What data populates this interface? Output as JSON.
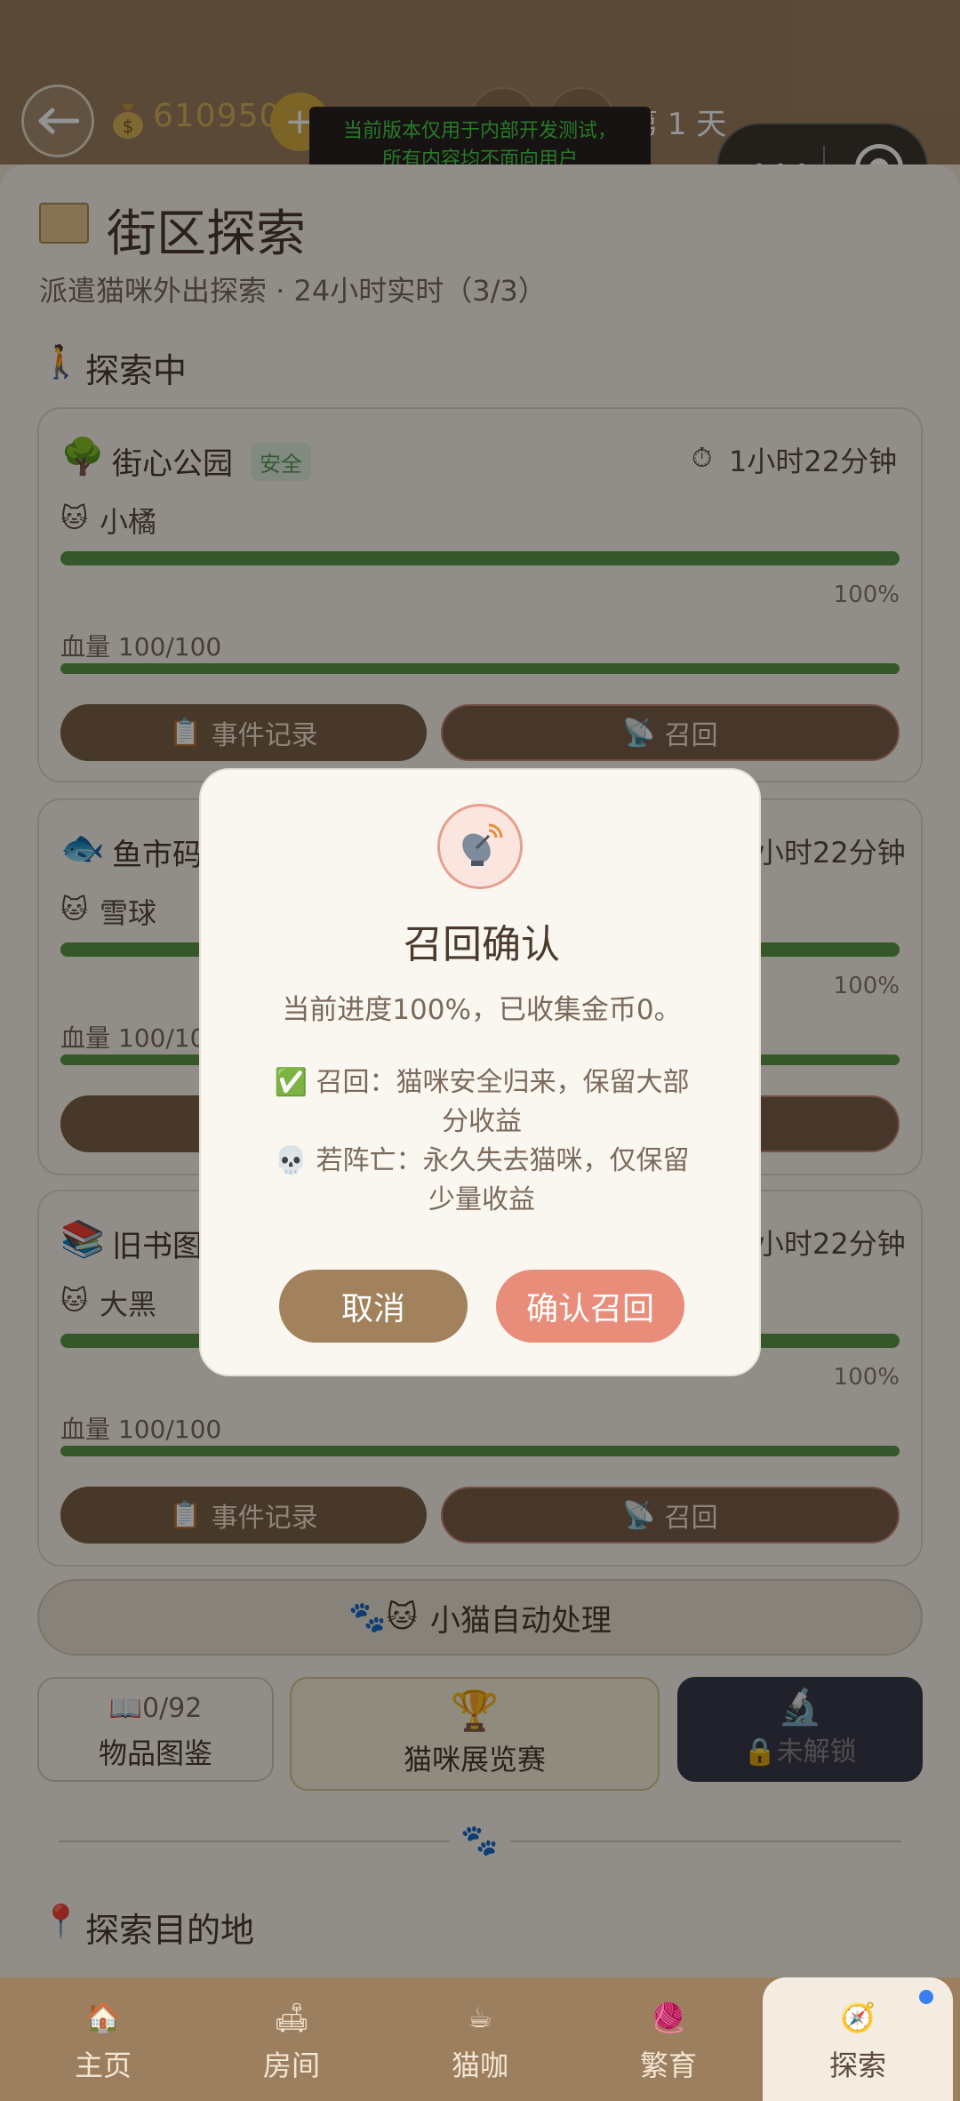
{
  "header": {
    "coins": "610950",
    "add_label": "+",
    "day_label": "第 1 天",
    "dev_notice_line1": "当前版本仅用于内部开发测试，",
    "dev_notice_line2": "所有内容均不面向用户"
  },
  "page": {
    "title": "街区探索",
    "subtitle": "派遣猫咪外出探索 · 24小时实时（3/3）",
    "exploring_title": "探索中",
    "destination_title": "探索目的地"
  },
  "explorations": [
    {
      "location": "街心公园",
      "badge": "安全",
      "timer": "1小时22分钟",
      "cat": "小橘",
      "progress_pct": 100,
      "progress_label": "100%",
      "hp_label": "血量 100/100",
      "hp_pct": 100,
      "log_label": "事件记录",
      "recall_label": "召回"
    },
    {
      "location": "鱼市码",
      "badge": "",
      "timer": "小时22分钟",
      "cat": "雪球",
      "progress_pct": 100,
      "progress_label": "100%",
      "hp_label": "血量 100/10",
      "hp_pct": 100,
      "log_label": "",
      "recall_label": ""
    },
    {
      "location": "旧书图",
      "badge": "",
      "timer": "小时22分钟",
      "cat": "大黑",
      "progress_pct": 100,
      "progress_label": "100%",
      "hp_label": "血量 100/100",
      "hp_pct": 100,
      "log_label": "事件记录",
      "recall_label": "召回"
    }
  ],
  "auto_button": "小猫自动处理",
  "tiles": {
    "catalog_count": "0/92",
    "catalog_label": "物品图鉴",
    "show_label": "猫咪展览赛",
    "locked_label": "未解锁"
  },
  "modal": {
    "title": "召回确认",
    "summary": "当前进度100%，已收集金币0。",
    "line1": "召回：猫咪安全归来，保留大部",
    "line1b": "分收益",
    "line2": "若阵亡：永久失去猫咪，仅保留",
    "line2b": "少量收益",
    "cancel": "取消",
    "confirm": "确认召回"
  },
  "tabs": [
    {
      "label": "主页",
      "icon": "home-icon"
    },
    {
      "label": "房间",
      "icon": "room-icon"
    },
    {
      "label": "猫咖",
      "icon": "cafe-icon"
    },
    {
      "label": "繁育",
      "icon": "breed-icon"
    },
    {
      "label": "探索",
      "icon": "explore-icon",
      "active": true
    }
  ],
  "colors": {
    "brand_brown": "#9c7f5f",
    "progress_green": "#5a9848",
    "confirm_coral": "#e88d7a",
    "coin_gold": "#d8b15a"
  }
}
